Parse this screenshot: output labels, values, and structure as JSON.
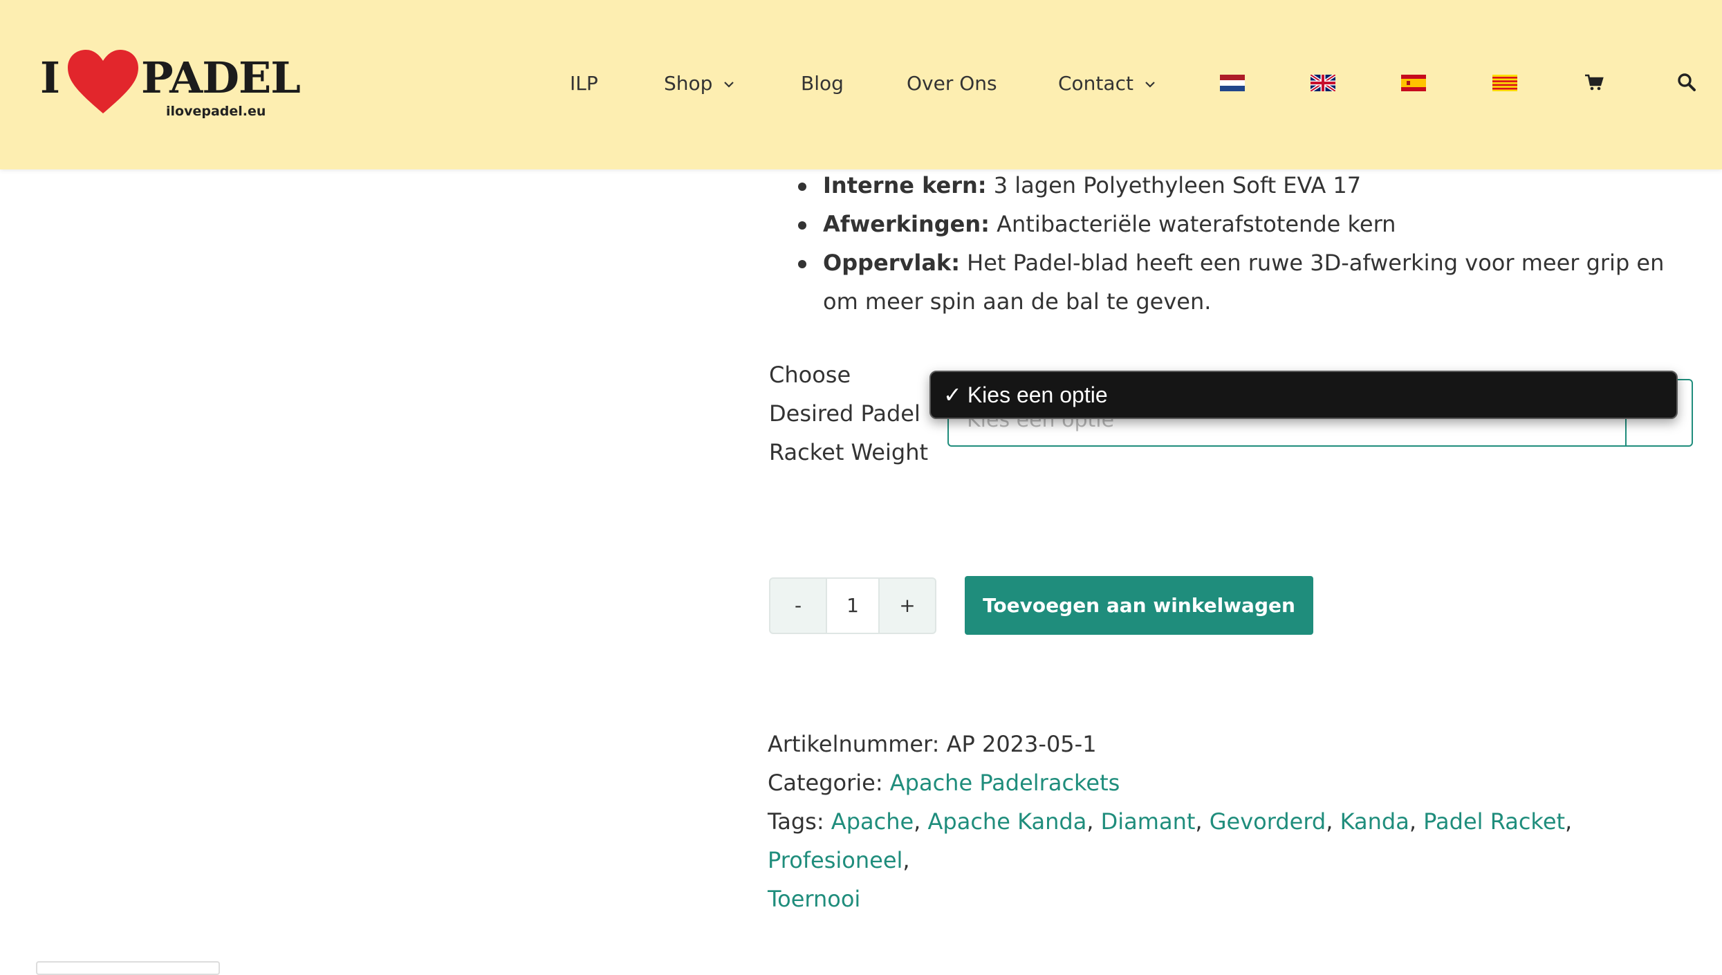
{
  "header": {
    "logo": {
      "letter_i": "I",
      "wordmark": "PADEL",
      "domain": "ilovepadel.eu"
    },
    "nav": [
      {
        "label": "ILP"
      },
      {
        "label": "Shop"
      },
      {
        "label": "Blog"
      },
      {
        "label": "Over Ons"
      },
      {
        "label": "Contact"
      }
    ],
    "flags": [
      "netherlands-flag",
      "uk-flag",
      "spain-flag",
      "catalonia-flag"
    ],
    "icons": [
      "cart-icon",
      "search-icon"
    ]
  },
  "product": {
    "specs": [
      {
        "label": "Interne kern:",
        "value": " 3 lagen Polyethyleen Soft EVA 17"
      },
      {
        "label": "Afwerkingen:",
        "value": " Antibacteriële waterafstotende kern"
      },
      {
        "label": "Oppervlak:",
        "value": " Het Padel-blad heeft een ruwe 3D-afwerking voor meer grip en om meer spin aan de bal te geven."
      }
    ],
    "weight_label": "Choose Desired Padel Racket Weight",
    "select": {
      "selected": "Kies een optie",
      "ghost_text": "Kies een optie"
    },
    "quantity": {
      "minus": "-",
      "value": "1",
      "plus": "+"
    },
    "add_to_cart": "Toevoegen aan winkelwagen",
    "meta": {
      "sku_label": "Artikelnummer:",
      "sku": "AP 2023-05-1",
      "category_label": "Categorie:",
      "category": "Apache Padelrackets",
      "tags_label": "Tags:",
      "tags": [
        "Apache",
        "Apache Kanda",
        "Diamant",
        "Gevorderd",
        "Kanda",
        "Padel Racket",
        "Profesioneel",
        "Toernooi"
      ]
    }
  },
  "colors": {
    "header_bg": "#fdeeb1",
    "accent": "#1f8d7c",
    "logo_heart": "#e2262c",
    "dropdown_bg": "#151515"
  }
}
